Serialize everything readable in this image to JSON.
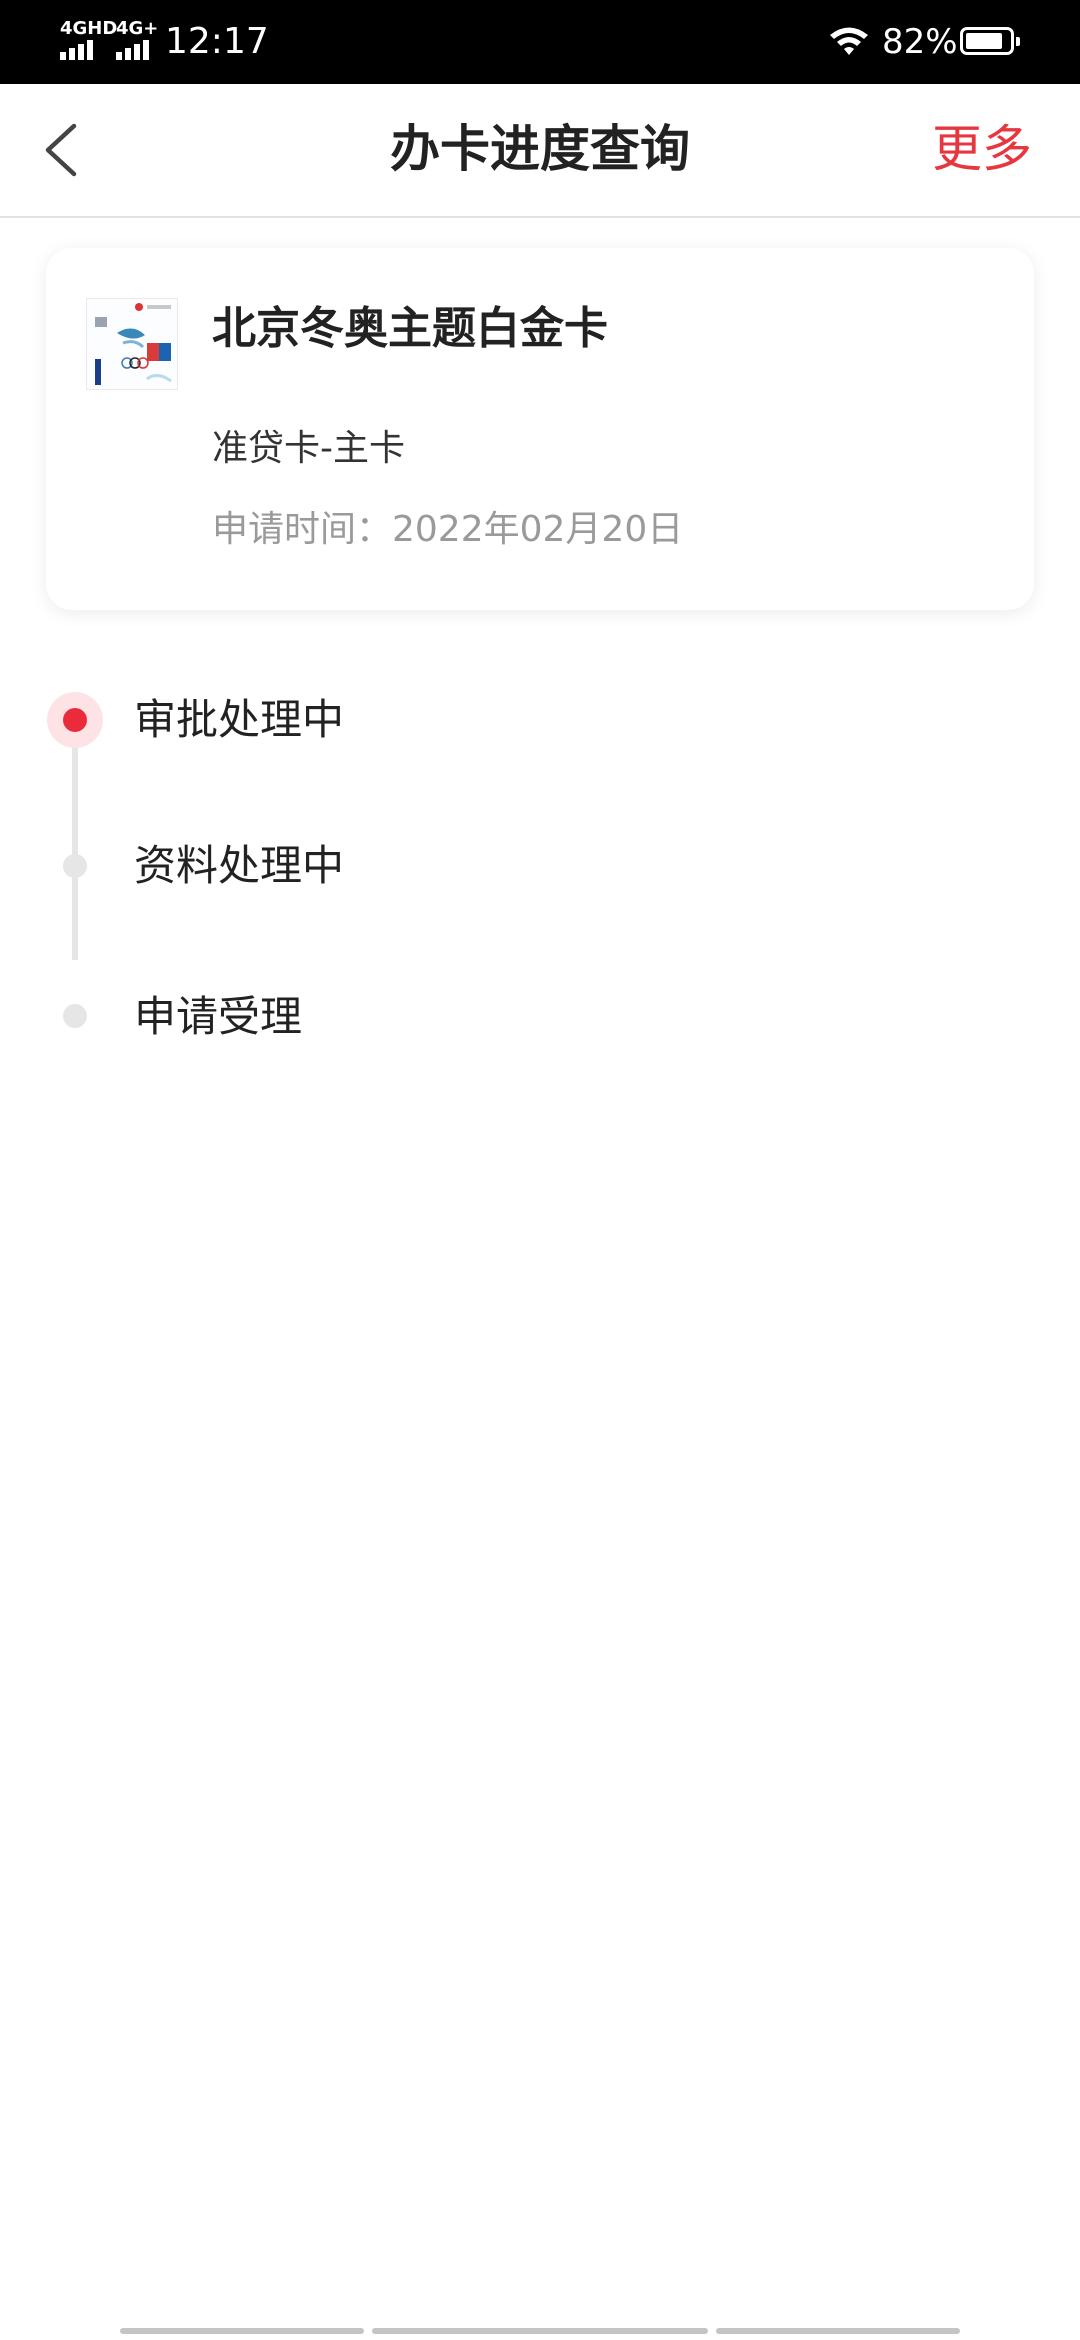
{
  "status_bar": {
    "signal1_label": "4GHD",
    "signal2_label": "4G+",
    "time": "12:17",
    "battery_text": "82%",
    "battery_level": 0.82,
    "icons": [
      "signal-icon",
      "wifi-icon",
      "battery-icon"
    ]
  },
  "nav": {
    "back_icon": "chevron-left-icon",
    "title": "办卡进度查询",
    "more_label": "更多",
    "accent_color": "#e8363f"
  },
  "card": {
    "name": "北京冬奥主题白金卡",
    "type": "准贷卡-主卡",
    "apply_time": "申请时间：2022年02月20日"
  },
  "timeline": {
    "active_color": "#ec2b3a",
    "steps": [
      {
        "label": "审批处理中",
        "active": true
      },
      {
        "label": "资料处理中",
        "active": false
      },
      {
        "label": "申请受理",
        "active": false
      }
    ]
  }
}
